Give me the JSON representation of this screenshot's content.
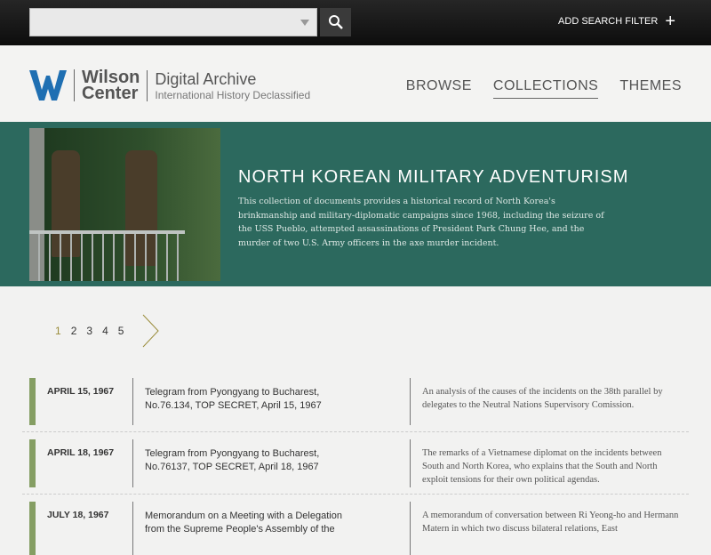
{
  "topbar": {
    "search_value": "",
    "filter_label": "ADD SEARCH FILTER",
    "filter_icon": "plus-icon"
  },
  "header": {
    "logo_line1": "Wilson",
    "logo_line2": "Center",
    "archive_title": "Digital Archive",
    "archive_subtitle": "International History Declassified",
    "nav": [
      {
        "label": "BROWSE"
      },
      {
        "label": "COLLECTIONS",
        "active": true
      },
      {
        "label": "THEMES"
      }
    ]
  },
  "hero": {
    "title": "NORTH KOREAN MILITARY ADVENTURISM",
    "description": "This collection of documents provides a historical record of North Korea's brinkmanship and military-diplomatic campaigns since 1968, including the seizure of the USS Pueblo, attempted assassinations of President Park Chung Hee, and the murder of two U.S. Army officers in the axe murder incident."
  },
  "pagination": {
    "pages": [
      "1",
      "2",
      "3",
      "4",
      "5"
    ],
    "current": "1"
  },
  "colors": {
    "accent": "#2c695e",
    "bar": "#859e63"
  },
  "documents": [
    {
      "date": "APRIL 15, 1967",
      "title": "Telegram from Pyongyang to Bucharest, No.76.134, TOP SECRET, April 15, 1967",
      "description": "An analysis of the causes of the incidents on the 38th parallel by delegates to the Neutral Nations Supervisory Comission."
    },
    {
      "date": "APRIL 18, 1967",
      "title": "Telegram from Pyongyang to Bucharest, No.76137, TOP SECRET, April 18, 1967",
      "description": "The remarks of a Vietnamese diplomat on the incidents between South and North Korea, who explains that the South and North exploit tensions for their own political agendas."
    },
    {
      "date": "JULY 18, 1967",
      "title": "Memorandum on a Meeting with a Delegation from the Supreme People's Assembly of the",
      "description": "A memorandum of conversation between Ri Yeong-ho and Hermann Matern in which two discuss bilateral relations, East"
    }
  ]
}
